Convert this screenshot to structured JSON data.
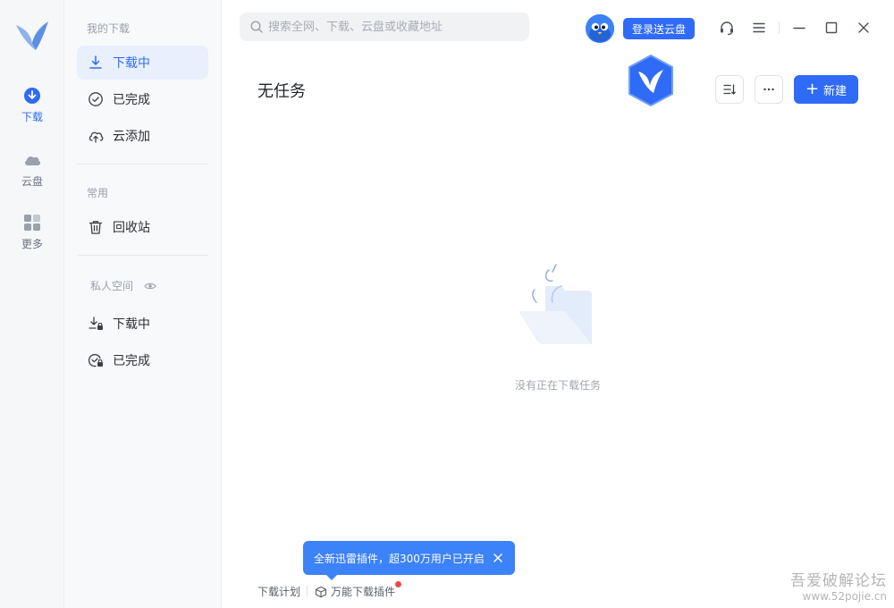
{
  "rail": {
    "items": [
      {
        "label": "下载",
        "icon": "download-circle-icon"
      },
      {
        "label": "云盘",
        "icon": "cloud-icon"
      },
      {
        "label": "更多",
        "icon": "grid-icon"
      }
    ]
  },
  "sidebar": {
    "section_downloads": "我的下载",
    "downloading": "下载中",
    "completed": "已完成",
    "cloud_add": "云添加",
    "section_common": "常用",
    "recycle_bin": "回收站",
    "section_private": "私人空间",
    "private_downloading": "下载中",
    "private_completed": "已完成"
  },
  "header": {
    "search_placeholder": "搜索全网、下载、云盘或收藏地址",
    "login_button": "登录送云盘"
  },
  "main": {
    "title": "无任务",
    "new_button": "新建",
    "empty_text": "没有正在下载任务"
  },
  "tooltip": {
    "text": "全新迅雷插件，超300万用户已开启"
  },
  "footer": {
    "plan": "下载计划",
    "plugin": "万能下载插件"
  },
  "watermark": {
    "line1": "吾爱破解论坛",
    "line2": "www.52pojie.cn"
  },
  "colors": {
    "accent": "#2f6bf6",
    "active_bg": "#e8effd",
    "badge_red": "#f04a4a"
  }
}
